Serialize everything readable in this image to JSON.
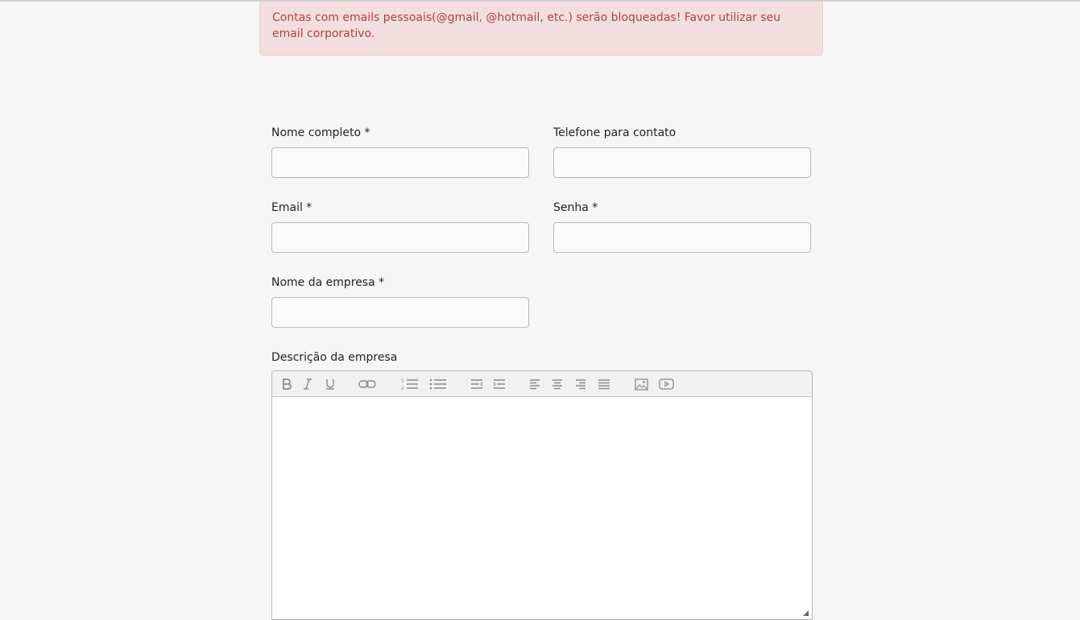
{
  "alert": {
    "text": "Contas com emails pessoais(@gmail, @hotmail, etc.) serão bloqueadas! Favor utilizar seu email corporativo."
  },
  "form": {
    "full_name": {
      "label": "Nome completo *",
      "value": ""
    },
    "phone": {
      "label": "Telefone para contato",
      "value": ""
    },
    "email": {
      "label": "Email *",
      "value": ""
    },
    "password": {
      "label": "Senha *",
      "value": ""
    },
    "company_name": {
      "label": "Nome da empresa *",
      "value": ""
    },
    "company_description": {
      "label": "Descrição da empresa",
      "value": ""
    }
  },
  "toolbar": {
    "icons": [
      "bold-icon",
      "italic-icon",
      "underline-icon",
      "link-icon",
      "ordered-list-icon",
      "unordered-list-icon",
      "outdent-icon",
      "indent-icon",
      "align-left-icon",
      "align-center-icon",
      "align-right-icon",
      "align-justify-icon",
      "image-icon",
      "video-icon"
    ]
  },
  "colors": {
    "alert_bg": "#f2dede",
    "alert_text": "#a94442",
    "page_bg": "#f6f6f6"
  }
}
